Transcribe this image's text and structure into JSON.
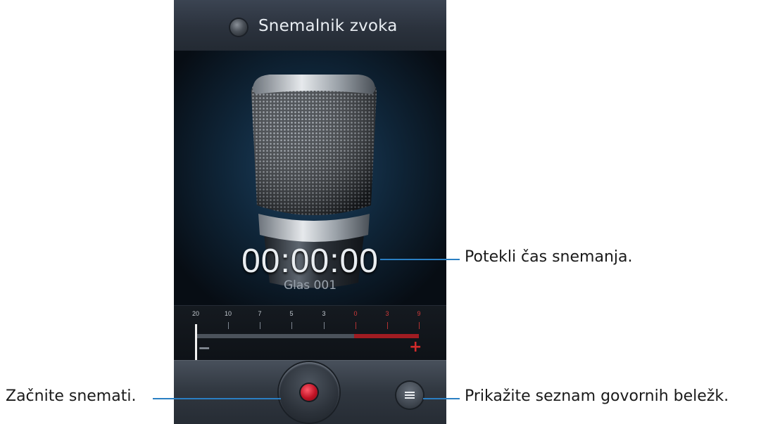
{
  "app": {
    "title": "Snemalnik zvoka",
    "icon": "app-icon"
  },
  "recorder": {
    "elapsed_time": "00:00:00",
    "file_name": "Glas 001"
  },
  "level_meter": {
    "scale": [
      {
        "label": "20",
        "red": false
      },
      {
        "label": "10",
        "red": false
      },
      {
        "label": "7",
        "red": false
      },
      {
        "label": "5",
        "red": false
      },
      {
        "label": "3",
        "red": false
      },
      {
        "label": "0",
        "red": true
      },
      {
        "label": "3",
        "red": true
      },
      {
        "label": "9",
        "red": true
      }
    ],
    "minus_symbol": "−",
    "plus_symbol": "+",
    "level": 0,
    "colors": {
      "normal": "#4b525b",
      "peak": "#a11c22"
    }
  },
  "controls": {
    "record_icon": "record-icon",
    "list_icon": "list-icon"
  },
  "callouts": {
    "elapsed_time": "Potekli čas snemanja.",
    "start_recording": "Začnite snemati.",
    "show_list": "Prikažite seznam govornih beležk."
  },
  "colors": {
    "leader_line": "#2a7fc3",
    "record_red": "#c01325"
  }
}
